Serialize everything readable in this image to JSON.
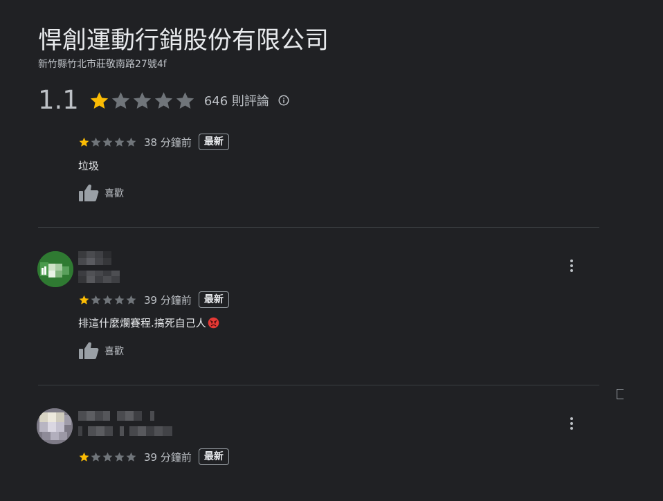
{
  "business": {
    "name": "悍創運動行銷股份有限公司",
    "address": "新竹縣竹北市莊敬南路27號4f"
  },
  "summary": {
    "average_rating": "1.1",
    "rating_value": 1.1,
    "rating_max": 5,
    "review_count": "646 則評論",
    "info_icon": "info-circle-icon"
  },
  "reviews": [
    {
      "stars": 1,
      "stars_max": 5,
      "time": "38 分鐘前",
      "badge": "最新",
      "text": "垃圾",
      "like_label": "喜歡",
      "like_icon": "thumbs-up-icon",
      "reviewer_hidden": true
    },
    {
      "stars": 1,
      "stars_max": 5,
      "time": "39 分鐘前",
      "badge": "最新",
      "text": "排這什麼爛賽程.搞死自己人",
      "emoji": "angry-face",
      "like_label": "喜歡",
      "like_icon": "thumbs-up-icon",
      "reviewer_hidden": true,
      "more_icon": "more-vert-icon"
    },
    {
      "stars": 1,
      "stars_max": 5,
      "time": "39 分鐘前",
      "badge": "最新",
      "reviewer_hidden": true,
      "more_icon": "more-vert-icon"
    }
  ],
  "colors": {
    "background": "#202124",
    "star_filled": "#fbbc04",
    "star_empty": "#70757a",
    "text_primary": "#e8eaed",
    "text_secondary": "#bdc1c6",
    "divider": "#3c4043"
  }
}
